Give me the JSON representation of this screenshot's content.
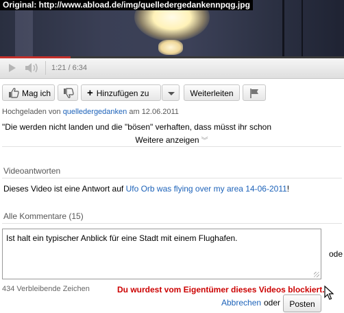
{
  "caption": "Original: http://www.abload.de/img/quelledergedankennpqg.jpg",
  "player": {
    "time": "1:21 / 6:34",
    "progress_fraction": 0.206
  },
  "actions": {
    "like_label": "Mag ich",
    "add_label": "Hinzufügen zu",
    "forward_label": "Weiterleiten"
  },
  "upload": {
    "prefix": "Hochgeladen von",
    "user": "quelledergedanken",
    "date_prefix": "am",
    "date": "12.06.2011"
  },
  "description": "\"Die werden nicht landen und die \"bösen\" verhaften, dass müsst ihr schon",
  "show_more": "Weitere anzeigen",
  "video_responses": {
    "heading": "Videoantworten",
    "text_prefix": "Dieses Video ist eine Antwort auf",
    "link_text": "Ufo Orb was flying over my area 14-06-2011",
    "text_suffix": "!"
  },
  "comments": {
    "heading": "Alle Kommentare (15)",
    "textarea_value": "Ist halt ein typischer Anblick für eine Stadt mit einem Flughafen.",
    "side_text": "ode",
    "remaining": "434 Verbleibende Zeichen",
    "blocked_message": "Du wurdest vom Eigentümer dieses Videos blockiert.",
    "cancel_label": "Abbrechen",
    "or_label": "oder",
    "post_label": "Posten"
  },
  "colors": {
    "link": "#1c62b9",
    "error": "#cc0000",
    "progress": "#c4302b"
  },
  "icons": [
    "play-icon",
    "volume-icon",
    "thumbs-up-icon",
    "thumbs-down-icon",
    "plus-icon",
    "chevron-down-icon",
    "flag-icon",
    "mouse-cursor-icon"
  ]
}
